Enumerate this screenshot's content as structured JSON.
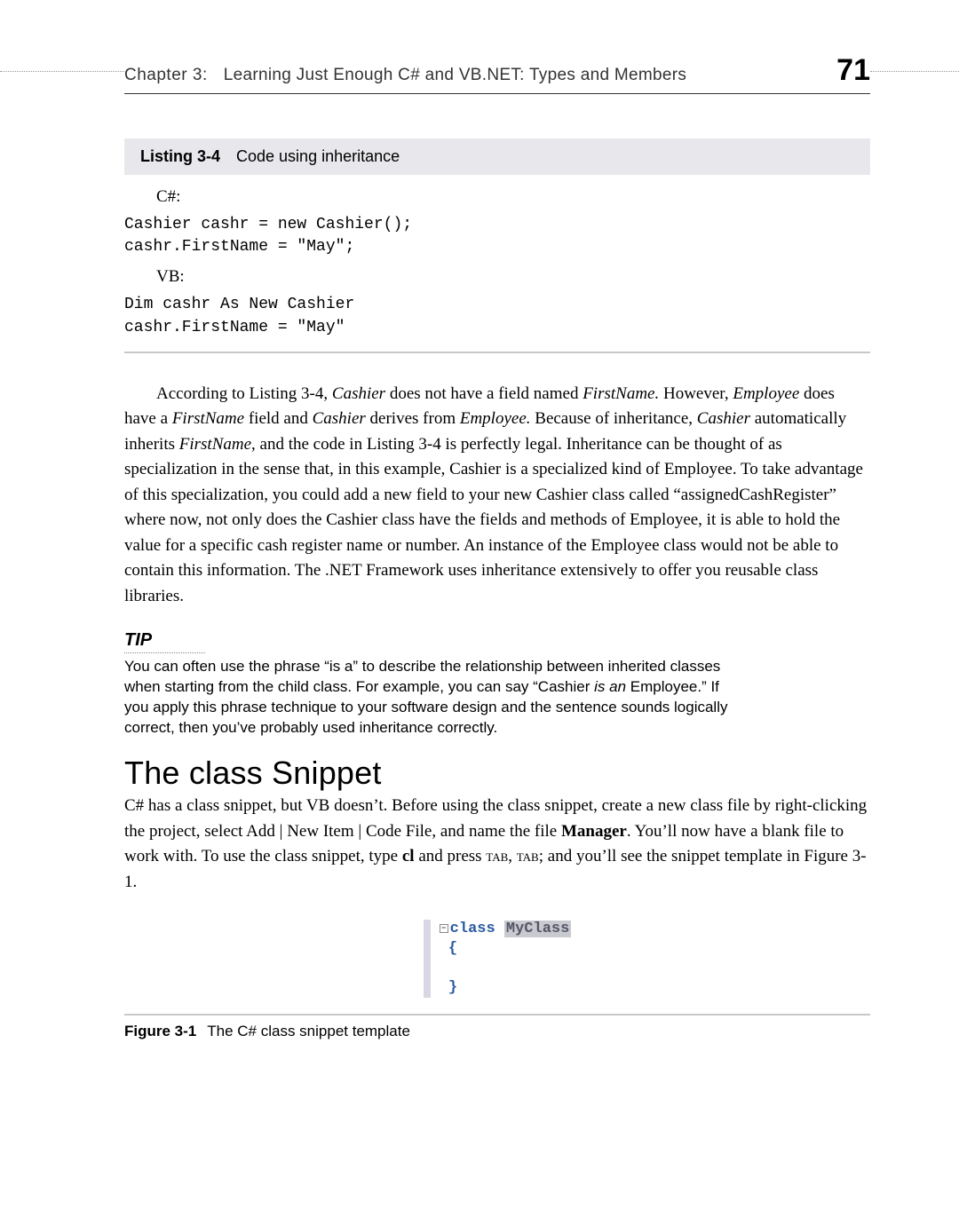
{
  "header": {
    "chapter_label": "Chapter 3:",
    "chapter_title": "Learning Just Enough C# and VB.NET: Types and Members",
    "page_number": "71"
  },
  "listing": {
    "label": "Listing 3-4",
    "title": "Code using inheritance",
    "csharp_label": "C#:",
    "csharp_code": "Cashier cashr = new Cashier();\ncashr.FirstName = \"May\";",
    "vb_label": "VB:",
    "vb_code": "Dim cashr As New Cashier\ncashr.FirstName = \"May\""
  },
  "paragraph1": {
    "t1": "According to Listing 3-4, ",
    "i1": "Cashier",
    "t2": " does not have a field named ",
    "i2": "FirstName.",
    "t3": " However, ",
    "i3": "Employee",
    "t4": " does have a ",
    "i4": "FirstName",
    "t5": " field and ",
    "i5": "Cashier",
    "t6": " derives from ",
    "i6": "Employee.",
    "t7": " Because of inheritance, ",
    "i7": "Cashier",
    "t8": " automatically inherits ",
    "i8": "FirstName",
    "t9": ", and the code in Listing 3-4 is perfectly legal. Inheritance can be thought of as specialization in the sense that, in this example, Cashier is a specialized kind of Employee. To take advantage of this specialization, you could add a new field to your new Cashier class called “assignedCashRegister” where now, not only does the Cashier class have the fields and methods of Employee, it is able to hold the value for a specific cash register name or number. An instance of the Employee class would not be able to contain this information. The .NET Framework uses inheritance extensively to offer you reusable class libraries."
  },
  "tip": {
    "heading": "TIP",
    "b1": "You can often use the phrase “is a” to describe the relationship between inherited classes when starting from the child class. For example, you can say “Cashier ",
    "i1": "is an",
    "b2": " Employee.” If you apply this phrase technique to your software design and the sentence sounds logically correct, then you’ve probably used inheritance correctly."
  },
  "section": {
    "heading": "The class Snippet",
    "b1": "C# has a class snippet, but VB doesn’t. Before using the class snippet, create a new class file by right-clicking the project, select Add | New Item | Code File, and name the file ",
    "bold1": "Manager",
    "b2": ". You’ll now have a blank file to work with. To use the class snippet, type ",
    "bold2": "cl",
    "b3": " and press ",
    "sc1": "tab",
    "b4": ", ",
    "sc2": "tab",
    "b5": "; and you’ll see the snippet template in Figure 3-1."
  },
  "snippet": {
    "keyword": "class",
    "classname": "MyClass",
    "open": "{",
    "close": "}"
  },
  "figure": {
    "label": "Figure 3-1",
    "caption": "The C# class snippet template"
  }
}
